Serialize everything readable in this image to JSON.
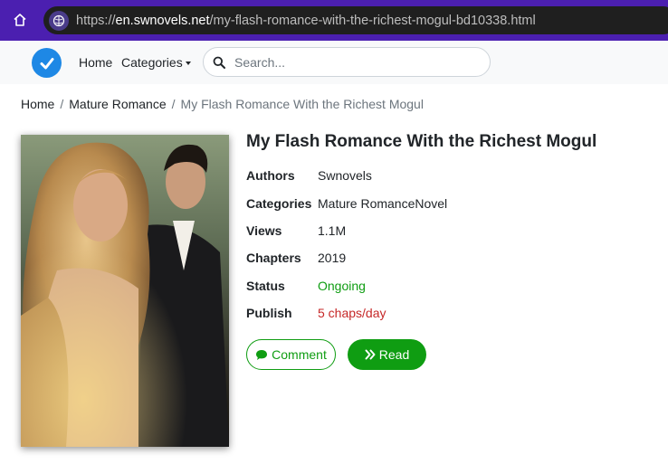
{
  "browser": {
    "url_scheme": "https://",
    "url_host": "en.swnovels.net",
    "url_path": "/my-flash-romance-with-the-richest-mogul-bd10338.html"
  },
  "nav": {
    "home_label": "Home",
    "categories_label": "Categories",
    "search_placeholder": "Search..."
  },
  "breadcrumb": {
    "items": [
      "Home",
      "Mature Romance"
    ],
    "current": "My Flash Romance With the Richest Mogul"
  },
  "book": {
    "title": "My Flash Romance With the Richest Mogul",
    "cover_icon": "book-cover-image",
    "info": [
      {
        "label": "Authors",
        "value": "Swnovels"
      },
      {
        "label": "Categories",
        "value": "Mature RomanceNovel"
      },
      {
        "label": "Views",
        "value": "1.1M"
      },
      {
        "label": "Chapters",
        "value": "2019"
      },
      {
        "label": "Status",
        "value": "Ongoing"
      },
      {
        "label": "Publish",
        "value": "5 chaps/day"
      }
    ]
  },
  "actions": {
    "comment_label": "Comment",
    "read_label": "Read"
  },
  "colors": {
    "browser_bar": "#4b1fb0",
    "accent_green": "#0f9d12",
    "publish_red": "#c62828",
    "logo_blue": "#1e88e5"
  }
}
